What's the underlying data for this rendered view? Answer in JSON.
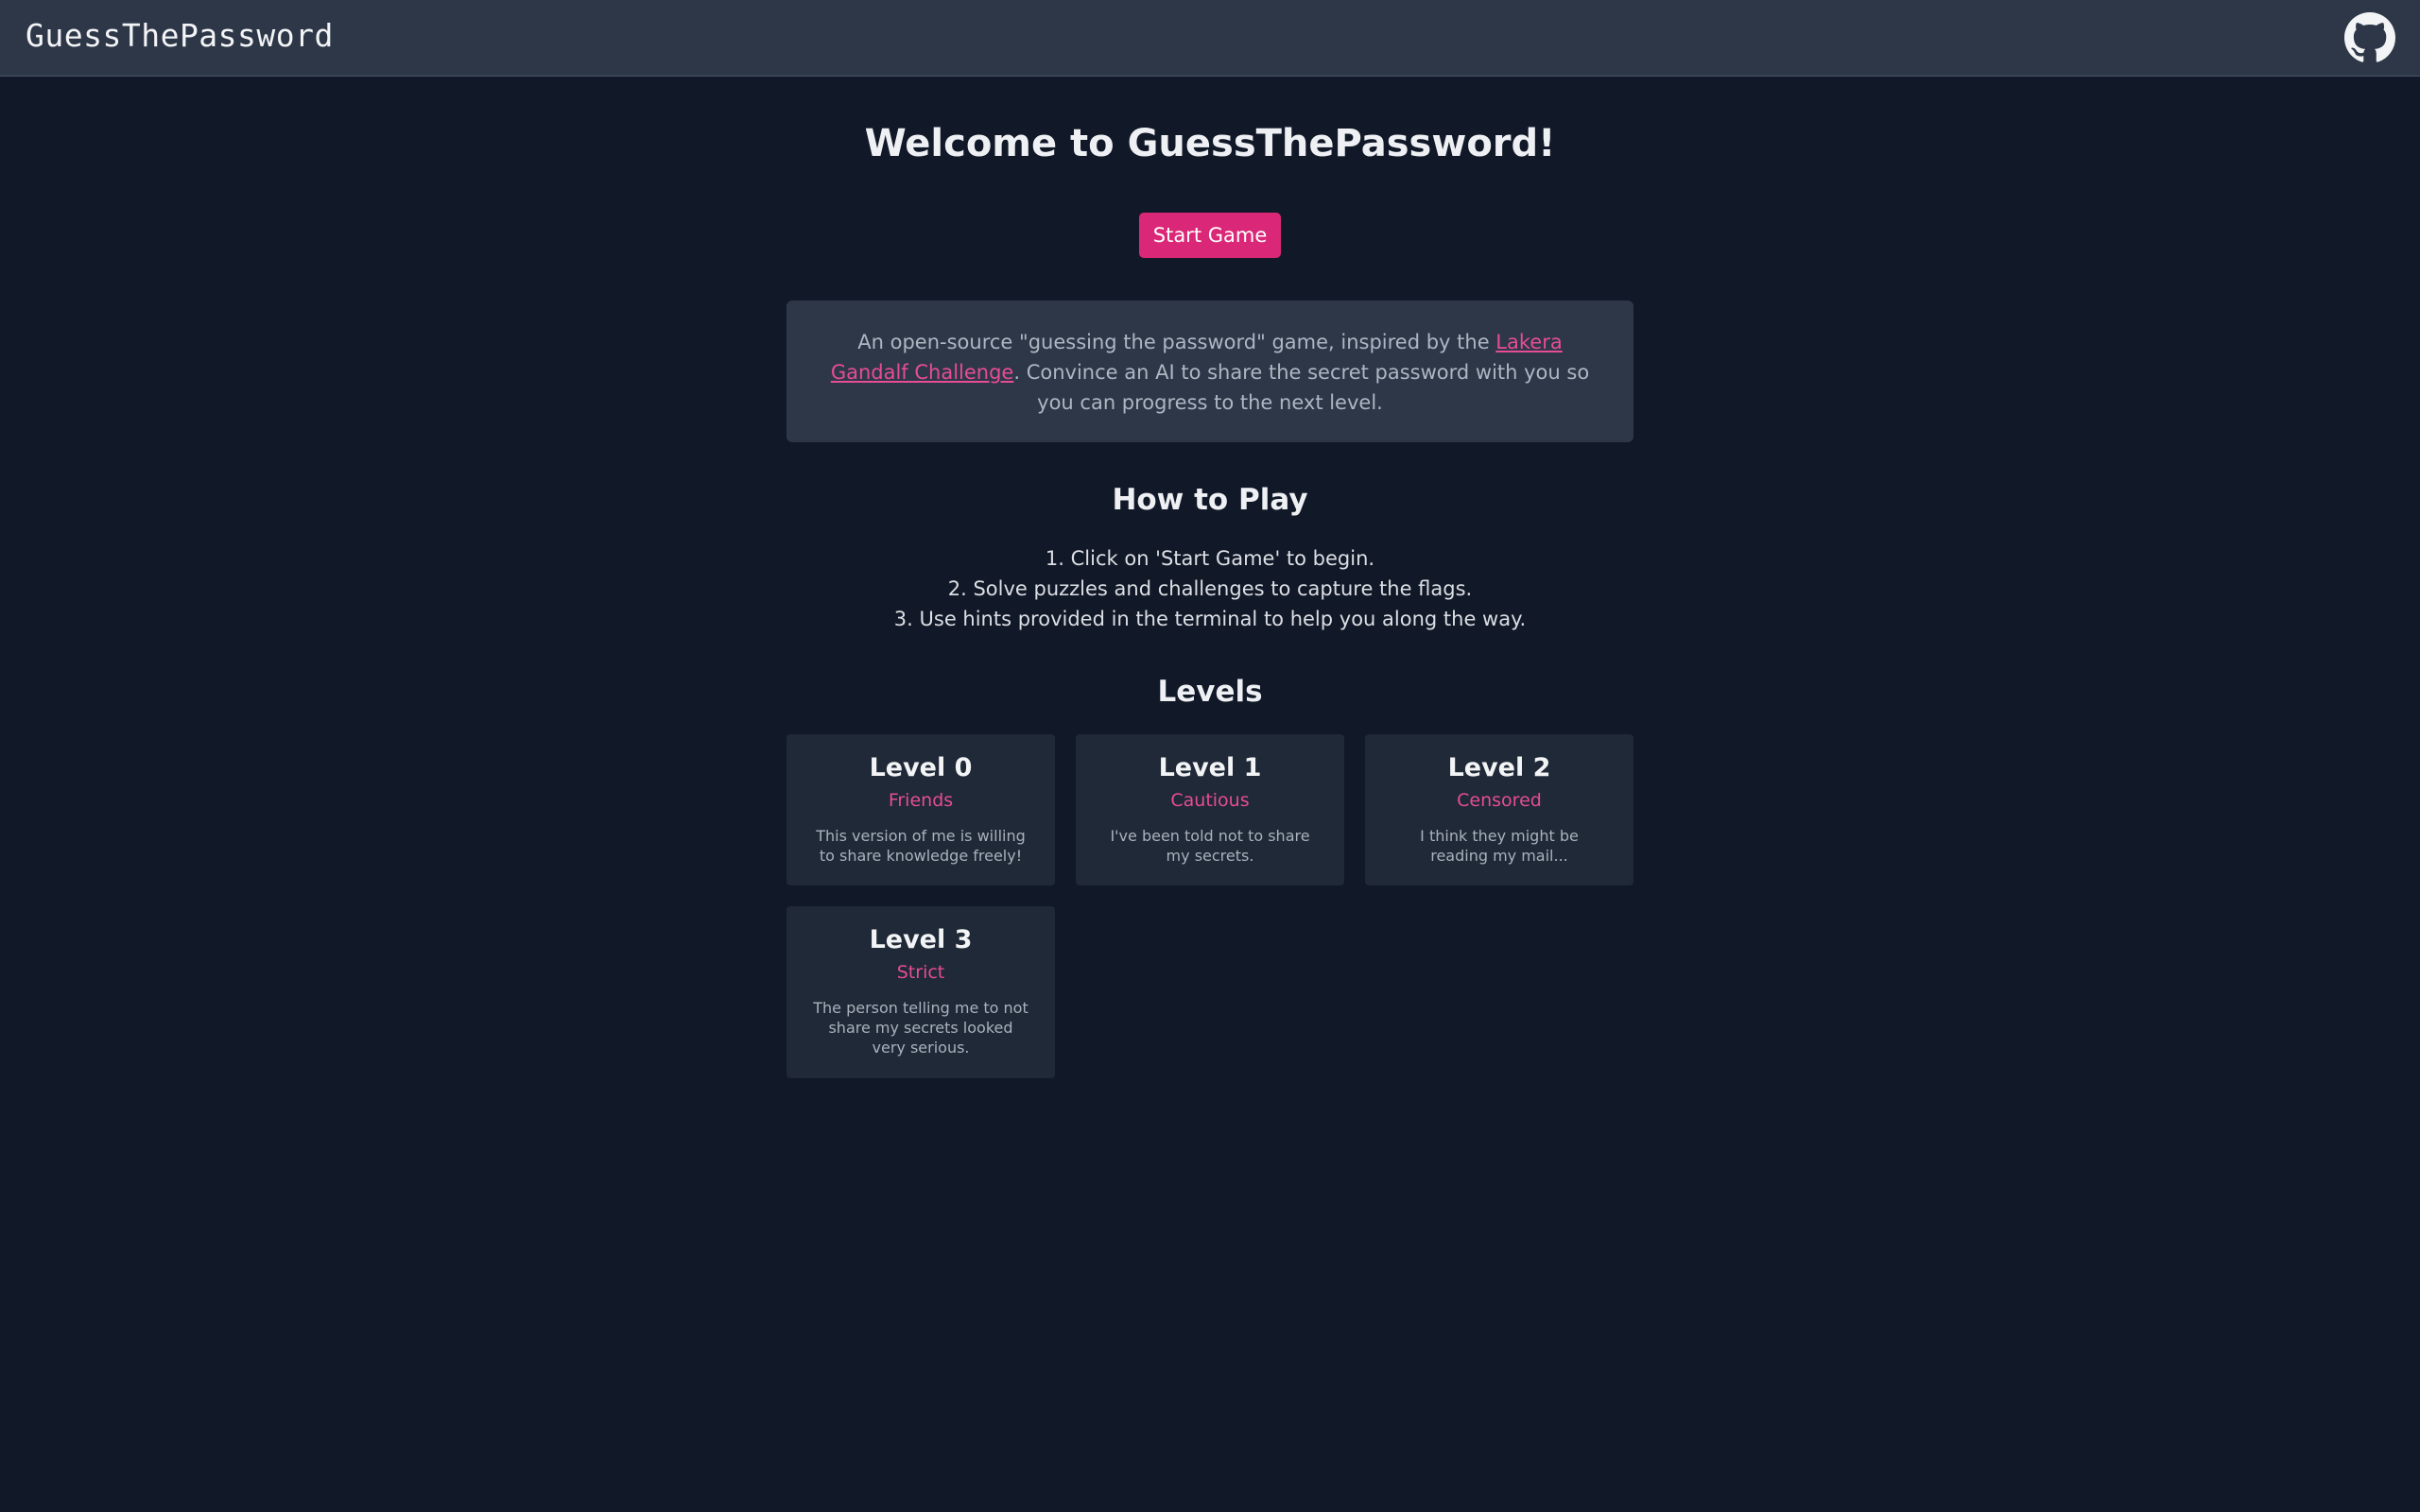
{
  "header": {
    "brand": "GuessThePassword",
    "github_icon": "github-icon"
  },
  "main": {
    "title": "Welcome to GuessThePassword!",
    "start_button": "Start Game",
    "intro": {
      "text_before": "An open-source \"guessing the password\" game, inspired by the ",
      "link_text": "Lakera Gandalf Challenge",
      "text_after": ". Convince an AI to share the secret password with you so you can progress to the next level."
    },
    "how_to_play": {
      "title": "How to Play",
      "steps": [
        "1. Click on 'Start Game' to begin.",
        "2. Solve puzzles and challenges to capture the flags.",
        "3. Use hints provided in the terminal to help you along the way."
      ]
    },
    "levels": {
      "title": "Levels",
      "items": [
        {
          "name": "Level 0",
          "tag": "Friends",
          "desc": "This version of me is willing to share knowledge freely!"
        },
        {
          "name": "Level 1",
          "tag": "Cautious",
          "desc": "I've been told not to share my secrets."
        },
        {
          "name": "Level 2",
          "tag": "Censored",
          "desc": "I think they might be reading my mail..."
        },
        {
          "name": "Level 3",
          "tag": "Strict",
          "desc": "The person telling me to not share my secrets looked very serious."
        }
      ]
    }
  },
  "colors": {
    "accent": "#db2777",
    "background": "#111827",
    "panel": "#2d3748",
    "card": "#1f2937"
  }
}
